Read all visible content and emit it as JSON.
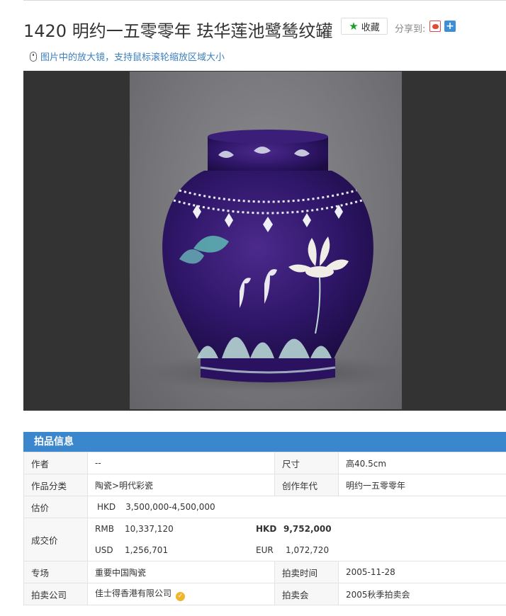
{
  "header": {
    "title": "1420 明约一五零零年 珐华莲池鹭鸶纹罐",
    "favorite_label": "收藏",
    "share_label": "分享到:"
  },
  "hint": "图片中的放大镜，支持鼠标滚轮缩放区域大小",
  "colors": {
    "section_head": "#3a87cd",
    "estimate": "#d22424",
    "favorite_star": "#1a9e28"
  },
  "info": {
    "section_title": "拍品信息",
    "author_label": "作者",
    "author_value": "--",
    "size_label": "尺寸",
    "size_value": "高40.5cm",
    "category_label": "作品分类",
    "category_value": "陶瓷>明代彩瓷",
    "year_label": "创作年代",
    "year_value": "明约一五零零年",
    "estimate_label": "估价",
    "estimate_currency": "HKD",
    "estimate_value": "3,500,000-4,500,000",
    "deal_label": "成交价",
    "deal_rmb_cur": "RMB",
    "deal_rmb": "10,337,120",
    "deal_hkd_cur": "HKD",
    "deal_hkd": "9,752,000",
    "deal_usd_cur": "USD",
    "deal_usd": "1,256,701",
    "deal_eur_cur": "EUR",
    "deal_eur": "1,072,720",
    "session_label": "专场",
    "session_value": "重要中国陶瓷",
    "date_label": "拍卖时间",
    "date_value": "2005-11-28",
    "company_label": "拍卖公司",
    "company_value": "佳士得香港有限公司",
    "auction_label": "拍卖会",
    "auction_value": "2005秋季拍卖会"
  }
}
